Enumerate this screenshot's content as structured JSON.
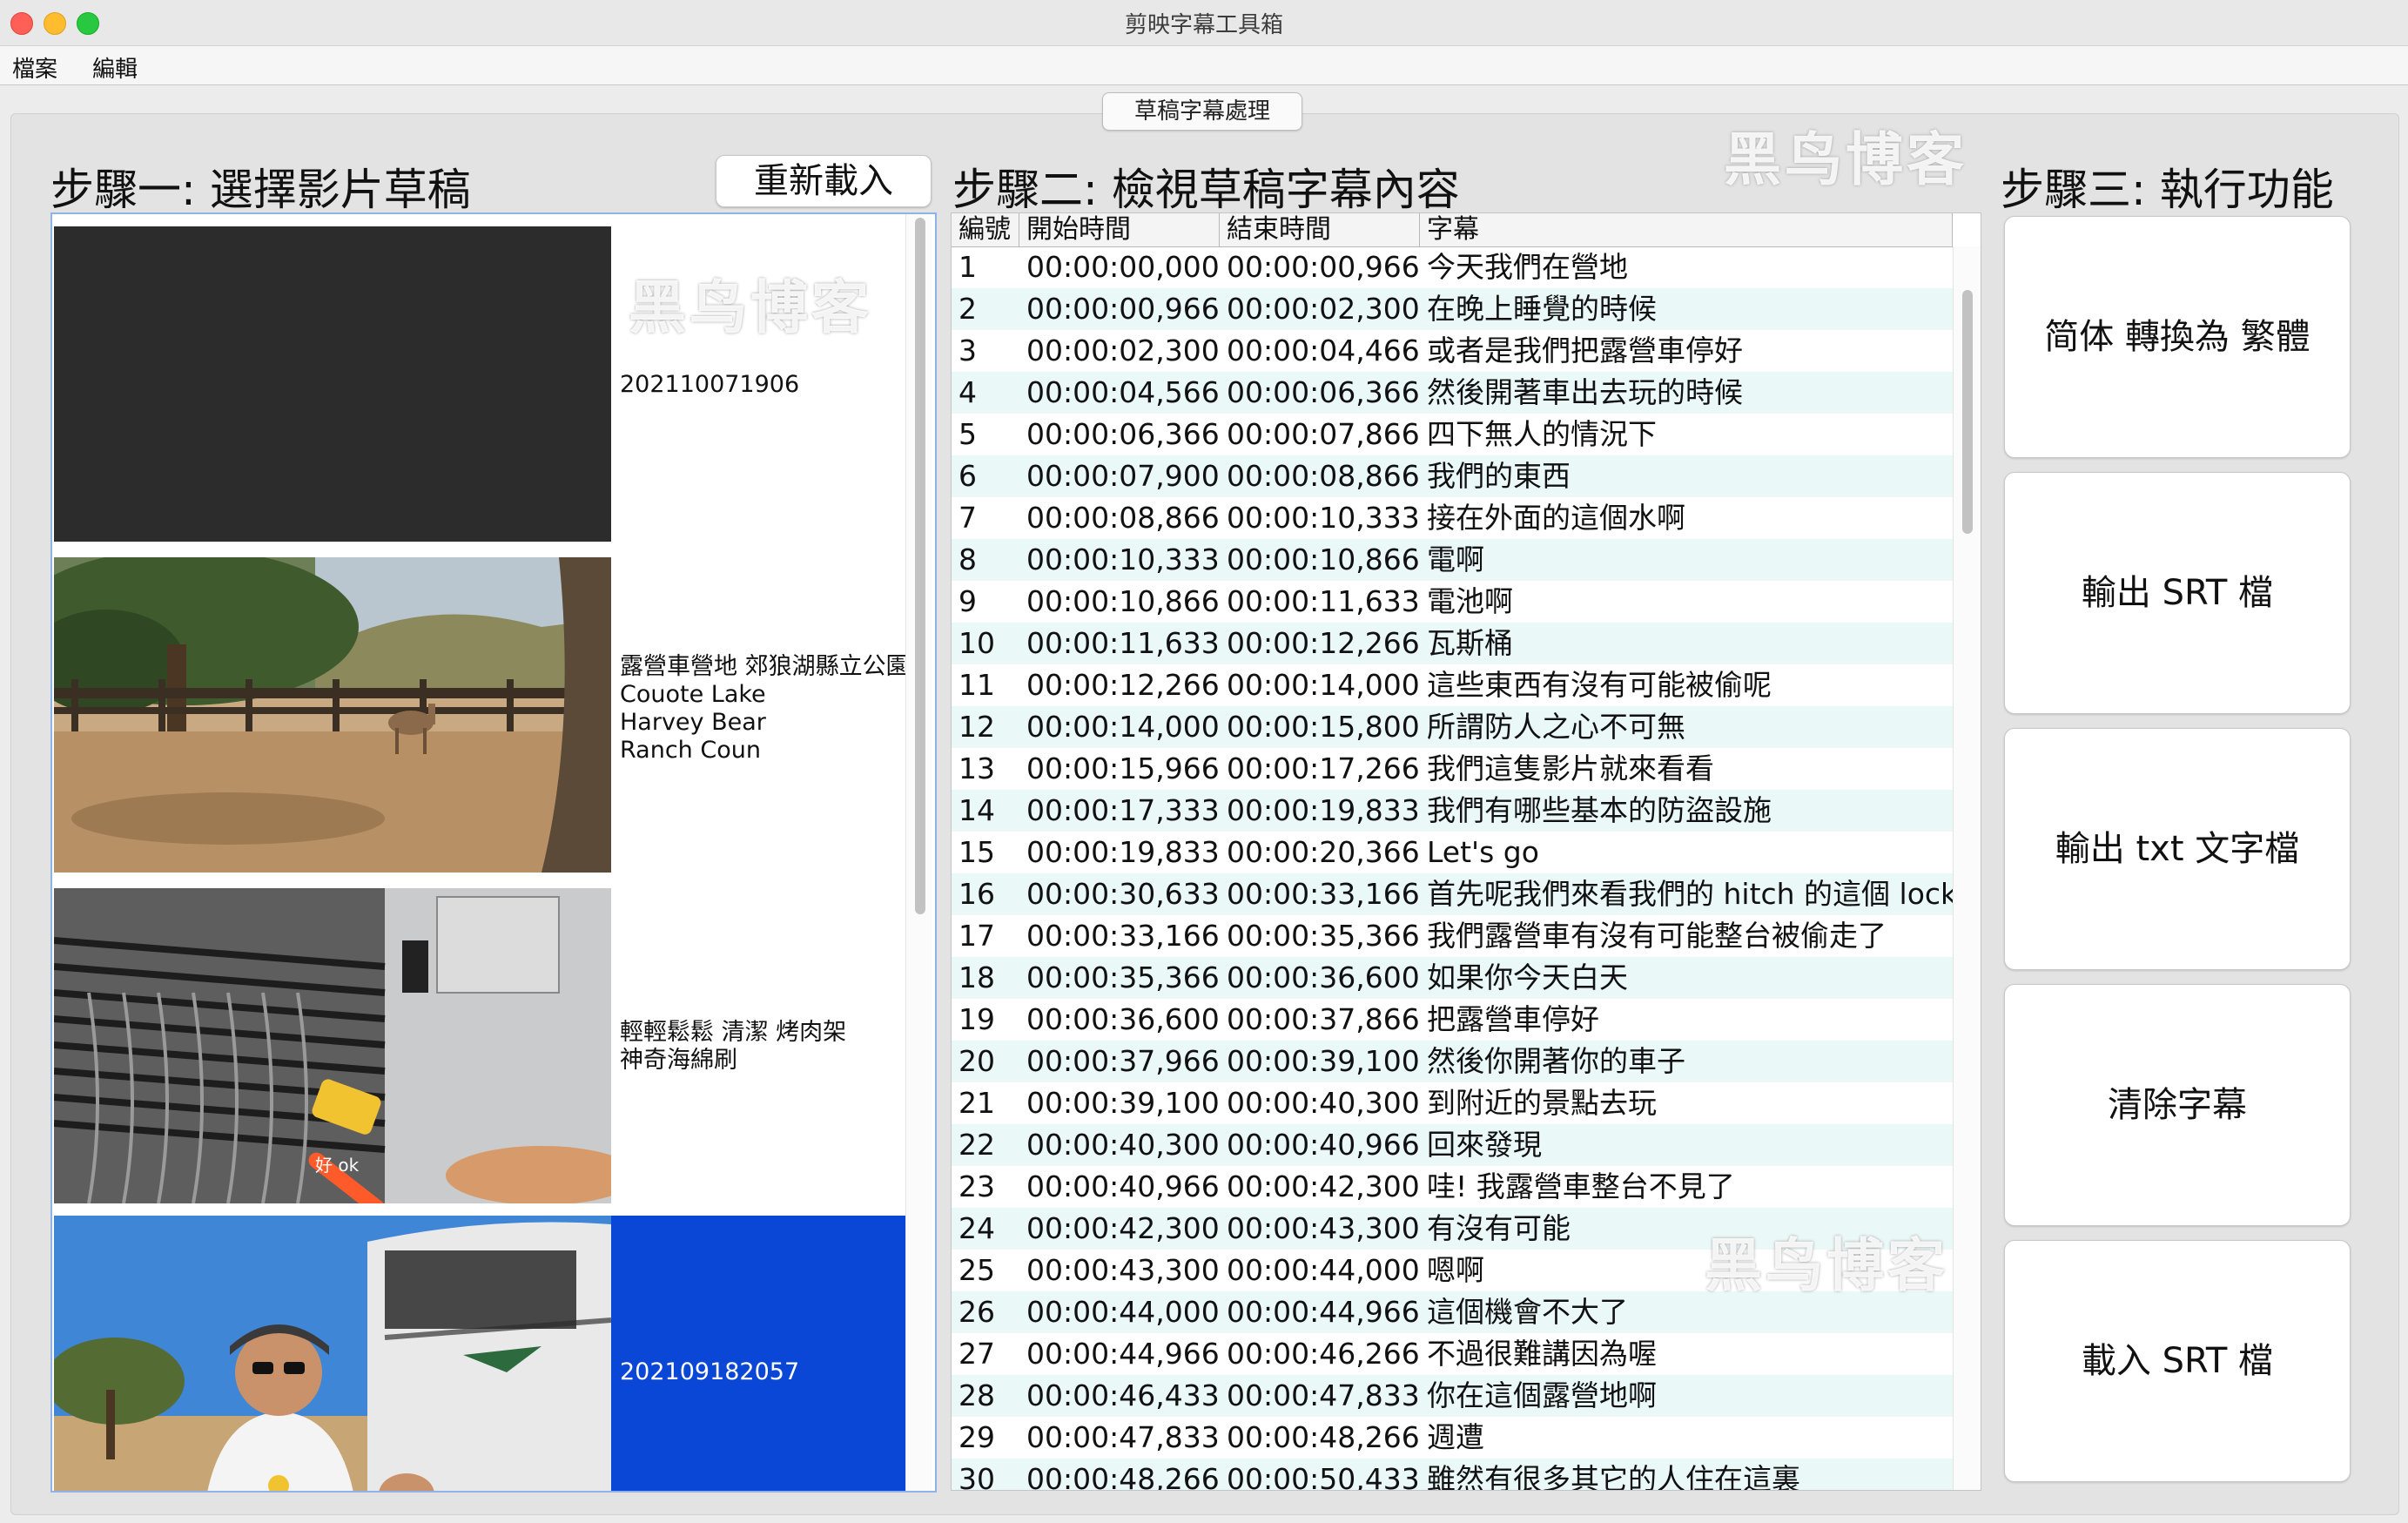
{
  "window": {
    "title": "剪映字幕工具箱"
  },
  "menu": {
    "file": "檔案",
    "edit": "編輯"
  },
  "tab": {
    "label": "草稿字幕處理"
  },
  "watermark": "黑鸟博客",
  "steps": {
    "one": {
      "title": "步驟一: 選擇影片草稿",
      "reload_label": "重新載入"
    },
    "two": {
      "title": "步驟二: 檢視草稿字幕內容"
    },
    "three": {
      "title": "步驟三: 執行功能"
    }
  },
  "videos": [
    {
      "lines": [
        "202110071906"
      ],
      "selected": false,
      "thumb": "dark-placeholder"
    },
    {
      "lines": [
        "露營車營地 郊狼湖縣立公園",
        "Couote Lake",
        "Harvey Bear",
        "Ranch Coun"
      ],
      "selected": false,
      "thumb": "park-deer"
    },
    {
      "lines": [
        "輕輕鬆鬆 清潔 烤肉架",
        "神奇海綿刷"
      ],
      "selected": false,
      "thumb": "grill-cleaning",
      "thumb_caption": "好 ok"
    },
    {
      "lines": [
        "202109182057"
      ],
      "selected": true,
      "thumb": "man-rv"
    }
  ],
  "table": {
    "columns": [
      "編號",
      "開始時間",
      "結束時間",
      "字幕"
    ],
    "rows": [
      [
        "1",
        "00:00:00,000",
        "00:00:00,966",
        "今天我們在營地"
      ],
      [
        "2",
        "00:00:00,966",
        "00:00:02,300",
        "在晚上睡覺的時候"
      ],
      [
        "3",
        "00:00:02,300",
        "00:00:04,466",
        "或者是我們把露營車停好"
      ],
      [
        "4",
        "00:00:04,566",
        "00:00:06,366",
        "然後開著車出去玩的時候"
      ],
      [
        "5",
        "00:00:06,366",
        "00:00:07,866",
        "四下無人的情況下"
      ],
      [
        "6",
        "00:00:07,900",
        "00:00:08,866",
        "我們的東西"
      ],
      [
        "7",
        "00:00:08,866",
        "00:00:10,333",
        "接在外面的這個水啊"
      ],
      [
        "8",
        "00:00:10,333",
        "00:00:10,866",
        "電啊"
      ],
      [
        "9",
        "00:00:10,866",
        "00:00:11,633",
        "電池啊"
      ],
      [
        "10",
        "00:00:11,633",
        "00:00:12,266",
        "瓦斯桶"
      ],
      [
        "11",
        "00:00:12,266",
        "00:00:14,000",
        "這些東西有沒有可能被偷呢"
      ],
      [
        "12",
        "00:00:14,000",
        "00:00:15,800",
        "所謂防人之心不可無"
      ],
      [
        "13",
        "00:00:15,966",
        "00:00:17,266",
        "我們這隻影片就來看看"
      ],
      [
        "14",
        "00:00:17,333",
        "00:00:19,833",
        "我們有哪些基本的防盜設施"
      ],
      [
        "15",
        "00:00:19,833",
        "00:00:20,366",
        "Let's go"
      ],
      [
        "16",
        "00:00:30,633",
        "00:00:33,166",
        "首先呢我們來看我們的 hitch 的這個 lock"
      ],
      [
        "17",
        "00:00:33,166",
        "00:00:35,366",
        "我們露營車有沒有可能整台被偷走了"
      ],
      [
        "18",
        "00:00:35,366",
        "00:00:36,600",
        "如果你今天白天"
      ],
      [
        "19",
        "00:00:36,600",
        "00:00:37,866",
        "把露營車停好"
      ],
      [
        "20",
        "00:00:37,966",
        "00:00:39,100",
        "然後你開著你的車子"
      ],
      [
        "21",
        "00:00:39,100",
        "00:00:40,300",
        "到附近的景點去玩"
      ],
      [
        "22",
        "00:00:40,300",
        "00:00:40,966",
        "回來發現"
      ],
      [
        "23",
        "00:00:40,966",
        "00:00:42,300",
        "哇! 我露營車整台不見了"
      ],
      [
        "24",
        "00:00:42,300",
        "00:00:43,300",
        "有沒有可能"
      ],
      [
        "25",
        "00:00:43,300",
        "00:00:44,000",
        "嗯啊"
      ],
      [
        "26",
        "00:00:44,000",
        "00:00:44,966",
        "這個機會不大了"
      ],
      [
        "27",
        "00:00:44,966",
        "00:00:46,266",
        "不過很難講因為喔"
      ],
      [
        "28",
        "00:00:46,433",
        "00:00:47,833",
        "你在這個露營地啊"
      ],
      [
        "29",
        "00:00:47,833",
        "00:00:48,266",
        "週遭"
      ],
      [
        "30",
        "00:00:48,266",
        "00:00:50,433",
        "雖然有很多其它的人住在這裏"
      ]
    ]
  },
  "actions": [
    {
      "label": "简体 轉換為 繁體"
    },
    {
      "label": "輸出 SRT 檔"
    },
    {
      "label": "輸出 txt 文字檔"
    },
    {
      "label": "清除字幕"
    },
    {
      "label": "載入 SRT 檔"
    }
  ]
}
